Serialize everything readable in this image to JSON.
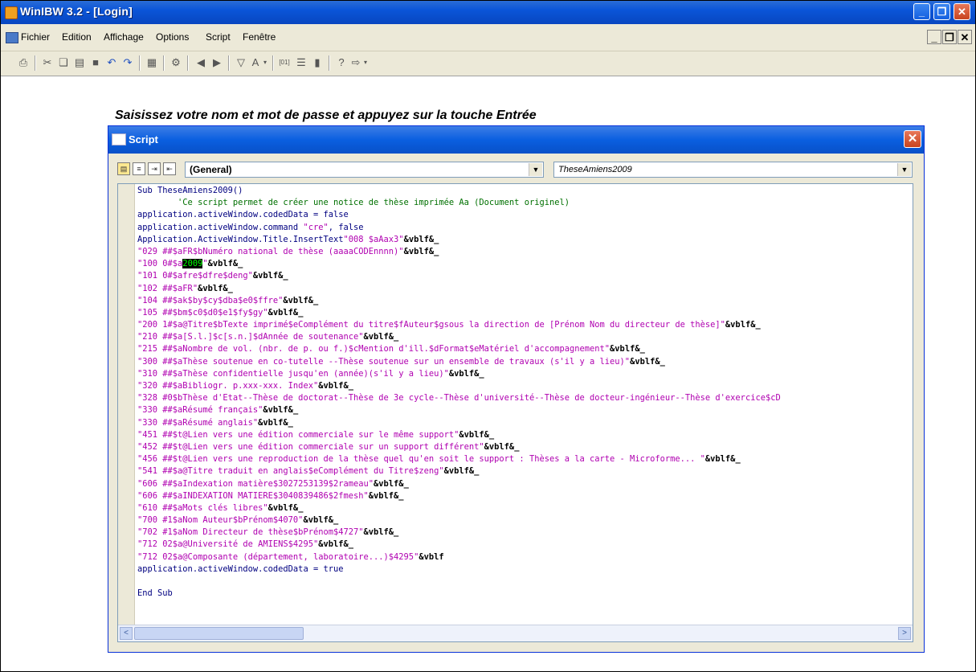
{
  "window": {
    "title": "WinIBW 3.2 - [Login]",
    "minimize": "_",
    "restore": "❐",
    "close": "✕"
  },
  "menubar": {
    "items": [
      "Fichier",
      "Edition",
      "Affichage",
      "Options",
      "Script",
      "Fenêtre"
    ],
    "mdi_min": "_",
    "mdi_restore": "❐",
    "mdi_close": "✕"
  },
  "toolbar": {
    "icons": [
      "print-icon",
      "cut-icon",
      "copy-icon",
      "paste-icon",
      "save-icon",
      "undo-icon",
      "redo-icon",
      "page-icon",
      "gear-icon",
      "back-icon",
      "forward-icon",
      "filter-icon",
      "format-icon",
      "dropdown-icon",
      "index-icon",
      "list-icon",
      "doc-icon",
      "help-icon",
      "arrow-icon",
      "dropdown-icon"
    ]
  },
  "prompt": "Saisissez votre nom et mot de passe et appuyez sur la touche Entrée",
  "script_window": {
    "title": "Script",
    "close": "✕",
    "object_combo": "(General)",
    "proc_combo": "TheseAmiens2009",
    "scroll_left": "<",
    "scroll_right": ">",
    "code_lines": [
      [
        {
          "t": "Sub TheseAmiens2009()",
          "c": "kw"
        }
      ],
      [
        {
          "t": "        'Ce script permet de créer une notice de thèse imprimée Aa (Document originel)",
          "c": "cm"
        }
      ],
      [
        {
          "t": "application.activeWindow.codedData = false",
          "c": "kw"
        }
      ],
      [
        {
          "t": "application.activeWindow.command ",
          "c": "kw"
        },
        {
          "t": "\"cre\"",
          "c": "st"
        },
        {
          "t": ", false",
          "c": "kw"
        }
      ],
      [
        {
          "t": "Application.ActiveWindow.Title.InsertText",
          "c": "kw"
        },
        {
          "t": "\"008 $aAax3\"",
          "c": "st"
        },
        {
          "t": "&vblf&_",
          "c": "ops"
        }
      ],
      [
        {
          "t": "\"029 ##$aFR$bNuméro national de thèse (aaaaCODEnnnn)\"",
          "c": "st"
        },
        {
          "t": "&vblf&_",
          "c": "ops"
        }
      ],
      [
        {
          "t": "\"100 0#$a",
          "c": "st"
        },
        {
          "t": "2009",
          "c": "sel"
        },
        {
          "t": "\"",
          "c": "st"
        },
        {
          "t": "&vblf&_",
          "c": "ops"
        }
      ],
      [
        {
          "t": "\"101 0#$afre$dfre$deng\"",
          "c": "st"
        },
        {
          "t": "&vblf&_",
          "c": "ops"
        }
      ],
      [
        {
          "t": "\"102 ##$aFR\"",
          "c": "st"
        },
        {
          "t": "&vblf&_",
          "c": "ops"
        }
      ],
      [
        {
          "t": "\"104 ##$ak$by$cy$dba$e0$ffre\"",
          "c": "st"
        },
        {
          "t": "&vblf&_",
          "c": "ops"
        }
      ],
      [
        {
          "t": "\"105 ##$bm$c0$d0$e1$fy$gy\"",
          "c": "st"
        },
        {
          "t": "&vblf&_",
          "c": "ops"
        }
      ],
      [
        {
          "t": "\"200 1#$a@Titre$bTexte imprimé$eComplément du titre$fAuteur$gsous la direction de [Prénom Nom du directeur de thèse]\"",
          "c": "st"
        },
        {
          "t": "&vblf&_",
          "c": "ops"
        }
      ],
      [
        {
          "t": "\"210 ##$a[S.l.]$c[s.n.]$dAnnée de soutenance\"",
          "c": "st"
        },
        {
          "t": "&vblf&_",
          "c": "ops"
        }
      ],
      [
        {
          "t": "\"215 ##$aNombre de vol. (nbr. de p. ou f.)$cMention d'ill.$dFormat$eMatériel d'accompagnement\"",
          "c": "st"
        },
        {
          "t": "&vblf&_",
          "c": "ops"
        }
      ],
      [
        {
          "t": "\"300 ##$aThèse soutenue en co-tutelle --Thèse soutenue sur un ensemble de travaux (s'il y a lieu)\"",
          "c": "st"
        },
        {
          "t": "&vblf&_",
          "c": "ops"
        }
      ],
      [
        {
          "t": "\"310 ##$aThèse confidentielle jusqu'en (année)(s'il y a lieu)\"",
          "c": "st"
        },
        {
          "t": "&vblf&_",
          "c": "ops"
        }
      ],
      [
        {
          "t": "\"320 ##$aBibliogr. p.xxx-xxx. Index\"",
          "c": "st"
        },
        {
          "t": "&vblf&_",
          "c": "ops"
        }
      ],
      [
        {
          "t": "\"328 #0$bThèse d'Etat--Thèse de doctorat--Thèse de 3e cycle--Thèse d'université--Thèse de docteur-ingénieur--Thèse d'exercice$cD",
          "c": "st"
        }
      ],
      [
        {
          "t": "\"330 ##$aRésumé français\"",
          "c": "st"
        },
        {
          "t": "&vblf&_",
          "c": "ops"
        }
      ],
      [
        {
          "t": "\"330 ##$aRésumé anglais\"",
          "c": "st"
        },
        {
          "t": "&vblf&_",
          "c": "ops"
        }
      ],
      [
        {
          "t": "\"451 ##$t@Lien vers une édition commerciale sur le même support\"",
          "c": "st"
        },
        {
          "t": "&vblf&_",
          "c": "ops"
        }
      ],
      [
        {
          "t": "\"452 ##$t@Lien vers une édition commerciale sur un support différent\"",
          "c": "st"
        },
        {
          "t": "&vblf&_",
          "c": "ops"
        }
      ],
      [
        {
          "t": "\"456 ##$t@Lien vers une reproduction de la thèse quel qu'en soit le support : Thèses a la carte - Microforme... \"",
          "c": "st"
        },
        {
          "t": "&vblf&_",
          "c": "ops"
        }
      ],
      [
        {
          "t": "\"541 ##$a@Titre traduit en anglais$eComplément du Titre$zeng\"",
          "c": "st"
        },
        {
          "t": "&vblf&_",
          "c": "ops"
        }
      ],
      [
        {
          "t": "\"606 ##$aIndexation matière$3027253139$2rameau\"",
          "c": "st"
        },
        {
          "t": "&vblf&_",
          "c": "ops"
        }
      ],
      [
        {
          "t": "\"606 ##$aINDEXATION MATIERE$3040839486$2fmesh\"",
          "c": "st"
        },
        {
          "t": "&vblf&_",
          "c": "ops"
        }
      ],
      [
        {
          "t": "\"610 ##$aMots clés libres\"",
          "c": "st"
        },
        {
          "t": "&vblf&_",
          "c": "ops"
        }
      ],
      [
        {
          "t": "\"700 #1$aNom Auteur$bPrénom$4070\"",
          "c": "st"
        },
        {
          "t": "&vblf&_",
          "c": "ops"
        }
      ],
      [
        {
          "t": "\"702 #1$aNom Directeur de thèse$bPrénom$4727\"",
          "c": "st"
        },
        {
          "t": "&vblf&_",
          "c": "ops"
        }
      ],
      [
        {
          "t": "\"712 02$a@Université de AMIENS$4295\"",
          "c": "st"
        },
        {
          "t": "&vblf&_",
          "c": "ops"
        }
      ],
      [
        {
          "t": "\"712 02$a@Composante (département, laboratoire...)$4295\"",
          "c": "st"
        },
        {
          "t": "&vblf",
          "c": "ops"
        }
      ],
      [
        {
          "t": "application.activeWindow.codedData = true",
          "c": "kw"
        }
      ],
      [
        {
          "t": "",
          "c": "kw"
        }
      ],
      [
        {
          "t": "End Sub",
          "c": "kw"
        }
      ]
    ]
  }
}
